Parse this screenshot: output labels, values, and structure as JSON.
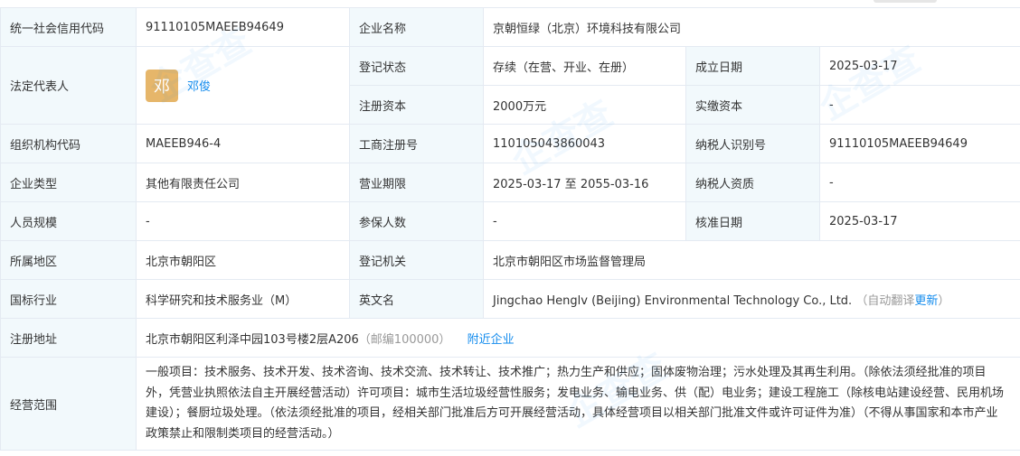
{
  "rows": {
    "credit_code": {
      "label": "统一社会信用代码",
      "value": "91110105MAEEB94649"
    },
    "company_name": {
      "label": "企业名称",
      "value": "京朝恒绿（北京）环境科技有限公司"
    },
    "legal_rep": {
      "label": "法定代表人",
      "avatar_char": "邓",
      "name": "邓俊"
    },
    "reg_status": {
      "label": "登记状态",
      "value": "存续（在营、开业、在册）"
    },
    "found_date": {
      "label": "成立日期",
      "value": "2025-03-17"
    },
    "reg_capital": {
      "label": "注册资本",
      "value": "2000万元"
    },
    "paid_capital": {
      "label": "实缴资本",
      "value": "-"
    },
    "org_code": {
      "label": "组织机构代码",
      "value": "MAEEB946-4"
    },
    "biz_reg_no": {
      "label": "工商注册号",
      "value": "110105043860043"
    },
    "taxpayer_id": {
      "label": "纳税人识别号",
      "value": "91110105MAEEB94649"
    },
    "company_type": {
      "label": "企业类型",
      "value": "其他有限责任公司"
    },
    "biz_term": {
      "label": "营业期限",
      "value": "2025-03-17 至 2055-03-16"
    },
    "taxpayer_qual": {
      "label": "纳税人资质",
      "value": "-"
    },
    "staff_size": {
      "label": "人员规模",
      "value": "-"
    },
    "insured": {
      "label": "参保人数",
      "value": "-"
    },
    "approval_date": {
      "label": "核准日期",
      "value": "2025-03-17"
    },
    "region": {
      "label": "所属地区",
      "value": "北京市朝阳区"
    },
    "reg_authority": {
      "label": "登记机关",
      "value": "北京市朝阳区市场监督管理局"
    },
    "industry": {
      "label": "国标行业",
      "value": "科学研究和技术服务业（M）"
    },
    "english_name": {
      "label": "英文名",
      "value": "Jingchao Henglv (Beijing) Environmental Technology Co., Ltd.",
      "auto_translate": "（自动翻译",
      "update": "更新",
      "close_paren": "）"
    },
    "address": {
      "label": "注册地址",
      "value": "北京市朝阳区利泽中园103号楼2层A206",
      "postcode": "（邮编100000）",
      "nearby": "附近企业"
    },
    "scope": {
      "label": "经营范围",
      "value": "一般项目：技术服务、技术开发、技术咨询、技术交流、技术转让、技术推广；热力生产和供应；固体废物治理；污水处理及其再生利用。（除依法须经批准的项目外，凭营业执照依法自主开展经营活动）许可项目：城市生活垃圾经营性服务；发电业务、输电业务、供（配）电业务；建设工程施工（除核电站建设经营、民用机场建设）；餐厨垃圾处理。（依法须经批准的项目，经相关部门批准后方可开展经营活动，具体经营项目以相关部门批准文件或许可证件为准）（不得从事国家和本市产业政策禁止和限制类项目的经营活动。）"
    }
  },
  "colors": {
    "label_bg": "#f2f9fc",
    "border": "#e4eaf2",
    "link": "#128bed",
    "avatar": "#e6b66a"
  }
}
